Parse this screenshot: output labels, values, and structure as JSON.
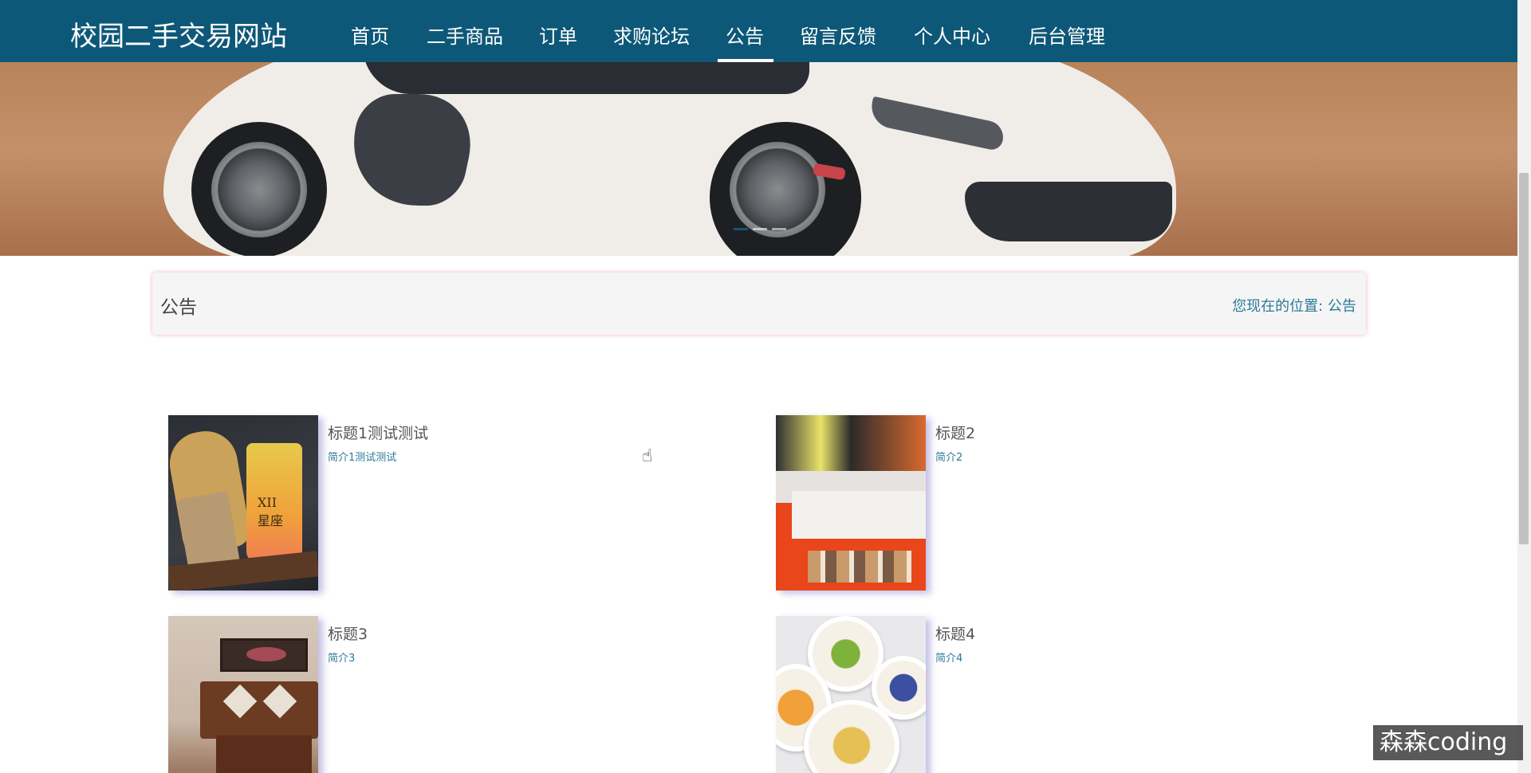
{
  "site": {
    "title": "校园二手交易网站"
  },
  "nav": {
    "items": [
      {
        "label": "首页"
      },
      {
        "label": "二手商品"
      },
      {
        "label": "订单"
      },
      {
        "label": "求购论坛"
      },
      {
        "label": "公告",
        "active": true
      },
      {
        "label": "留言反馈"
      },
      {
        "label": "个人中心"
      },
      {
        "label": "后台管理"
      }
    ]
  },
  "banner": {
    "image": "white-sports-car-photo",
    "slide_count": 3,
    "active_slide": 1
  },
  "breadcrumb": {
    "page_title": "公告",
    "location_label": "您现在的位置:",
    "location_value": "公告"
  },
  "notices": [
    {
      "title": "标题1测试测试",
      "desc": "简介1测试测试",
      "image": "bubble-waffle-and-tea-photo"
    },
    {
      "title": "标题2",
      "desc": "简介2",
      "image": "shop-display-photo"
    },
    {
      "title": "标题3",
      "desc": "简介3",
      "image": "living-room-photo"
    },
    {
      "title": "标题4",
      "desc": "简介4",
      "image": "fruit-bowls-photo"
    }
  ],
  "watermark": {
    "text": "森森coding"
  },
  "colors": {
    "nav_bg": "#0d5878",
    "link": "#2b7a99",
    "crumb_bg": "#f5f5f5"
  }
}
